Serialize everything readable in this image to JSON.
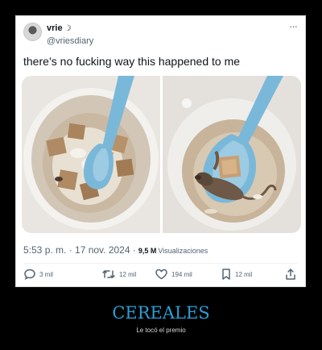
{
  "tweet": {
    "author_name": "vrie",
    "moon_glyph": "☽",
    "handle": "@vriesdiary",
    "more_glyph": "···",
    "text": "there’s no fucking way this happened to me",
    "timestamp": "5:53 p. m. · 17 nov. 2024 ·",
    "views_count": "9,5 M",
    "views_label": "Visualizaciones"
  },
  "images": [
    {
      "name": "cereal-bowl-photo-left",
      "content": "bowl of milk with square cereal and blue spoon"
    },
    {
      "name": "cereal-bowl-photo-right",
      "content": "blue spoon holding cereal and a dead mouse"
    }
  ],
  "actions": {
    "replies": "3 mil",
    "retweets": "12 mil",
    "likes": "194 mil",
    "bookmarks": "12 mil"
  },
  "icons": {
    "reply": "reply-icon",
    "retweet": "retweet-icon",
    "like": "heart-icon",
    "bookmark": "bookmark-icon",
    "share": "share-icon"
  },
  "caption": {
    "title": "CEREALES",
    "subtitle": "Le tocó el premio"
  },
  "colors": {
    "page_background": "#000000",
    "card_background": "#ffffff",
    "caption_title": "#2a9fd6",
    "muted_text": "#536471",
    "spoon_blue": "#7ab8d9"
  }
}
